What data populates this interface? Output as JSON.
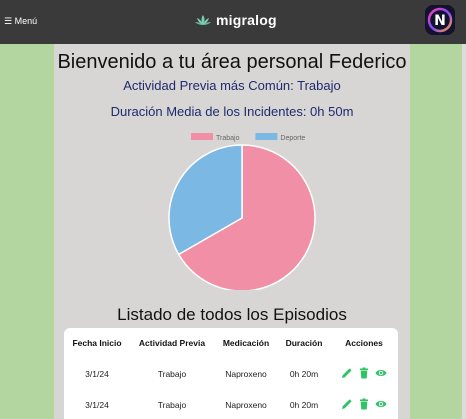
{
  "topbar": {
    "menu_label": "☰ Menú",
    "brand": "migralog",
    "brand_icon": "lotus-icon",
    "avatar_letter": "N"
  },
  "dashboard": {
    "welcome": "Bienvenido a tu área personal Federico",
    "most_common_activity": "Actividad Previa más Común: Trabajo",
    "avg_duration": "Duración Media de los Incidentes: 0h 50m"
  },
  "colors": {
    "trabajo": "#f08fa5",
    "deporte": "#7bb8e4",
    "action_green": "#2fc463",
    "title_navy": "#1f2a6e"
  },
  "chart_data": {
    "type": "pie",
    "legend_position": "top",
    "categories": [
      "Trabajo",
      "Deporte"
    ],
    "values": [
      66.7,
      33.3
    ],
    "colors": [
      "#f08fa5",
      "#7bb8e4"
    ]
  },
  "episodes": {
    "title": "Listado de todos los Episodios",
    "headers": [
      "Fecha Inicio",
      "Actividad Previa",
      "Medicación",
      "Duración",
      "Acciones"
    ],
    "rows": [
      {
        "fecha": "3/1/24",
        "actividad": "Trabajo",
        "medicacion": "Naproxeno",
        "duracion": "0h 20m"
      },
      {
        "fecha": "3/1/24",
        "actividad": "Trabajo",
        "medicacion": "Naproxeno",
        "duracion": "0h 20m"
      }
    ],
    "action_icons": [
      "edit-icon",
      "delete-icon",
      "view-icon"
    ]
  }
}
